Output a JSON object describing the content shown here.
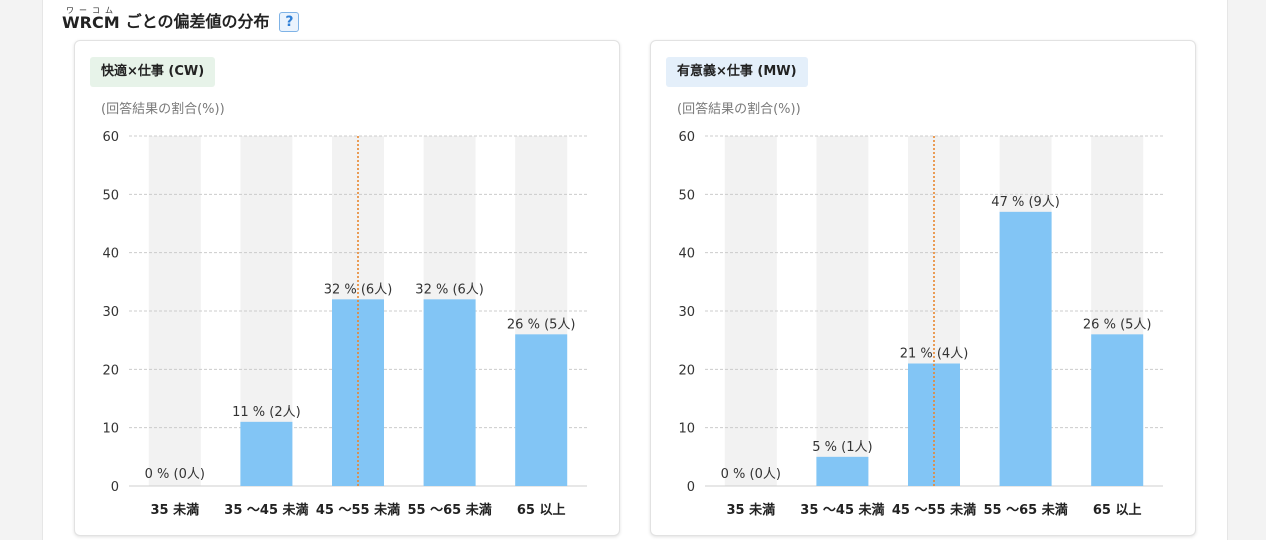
{
  "section": {
    "title_word": "WRCM",
    "title_ruby": "ワーコム",
    "title_rest": " ごとの偏差値の分布",
    "help_label": "?"
  },
  "chart_data": [
    {
      "type": "bar",
      "badge": "快適×仕事 (CW)",
      "unit_label": "(回答結果の割合(%))",
      "categories": [
        "35 未満",
        "35 〜45 未満",
        "45 〜55 未満",
        "55 〜65 未満",
        "65 以上"
      ],
      "values": [
        0,
        11,
        32,
        32,
        26
      ],
      "data_labels": [
        "0 % (0人)",
        "11 % (2人)",
        "32 % (6人)",
        "32 % (6人)",
        "26 % (5人)"
      ],
      "ylim": [
        0,
        60
      ],
      "yticks": [
        "0",
        "10",
        "20",
        "30",
        "40",
        "50",
        "60"
      ],
      "grid": true,
      "marker_category_index": 2,
      "colors": {
        "bar": "#82c5f5",
        "track": "#f2f2f2",
        "marker": "#e8862f",
        "badge_bg": "#e7f3e9"
      }
    },
    {
      "type": "bar",
      "badge": "有意義×仕事 (MW)",
      "unit_label": "(回答結果の割合(%))",
      "categories": [
        "35 未満",
        "35 〜45 未満",
        "45 〜55 未満",
        "55 〜65 未満",
        "65 以上"
      ],
      "values": [
        0,
        5,
        21,
        47,
        26
      ],
      "data_labels": [
        "0 % (0人)",
        "5 % (1人)",
        "21 % (4人)",
        "47 % (9人)",
        "26 % (5人)"
      ],
      "ylim": [
        0,
        60
      ],
      "yticks": [
        "0",
        "10",
        "20",
        "30",
        "40",
        "50",
        "60"
      ],
      "grid": true,
      "marker_category_index": 2,
      "colors": {
        "bar": "#82c5f5",
        "track": "#f2f2f2",
        "marker": "#e8862f",
        "badge_bg": "#e4effa"
      }
    }
  ]
}
